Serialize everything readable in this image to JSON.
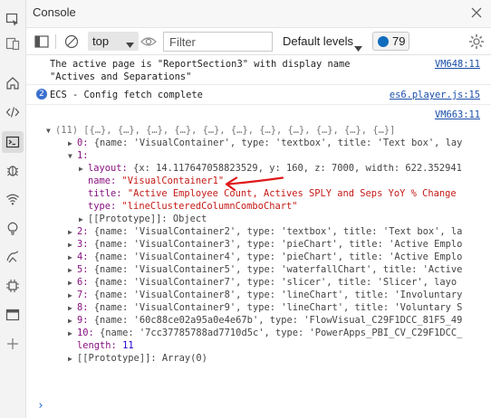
{
  "header": {
    "title": "Console"
  },
  "toolbar": {
    "context": "top",
    "filter_placeholder": "Filter",
    "levels_label": "Default levels",
    "issues_count": "79"
  },
  "messages": [
    {
      "text": "The active page is \"ReportSection3\" with display name\n\"Actives and Separations\"",
      "source": "VM648:11"
    },
    {
      "badge": "2",
      "text": "ECS - Config fetch complete",
      "source": "es6.player.js:15"
    },
    {
      "source": "VM663:11"
    }
  ],
  "object": {
    "summary": "(11) [{…}, {…}, {…}, {…}, {…}, {…}, {…}, {…}, {…}, {…}, {…}]",
    "item0": "{name: 'VisualContainer', type: 'textbox', title: 'Text box', lay",
    "item1_layout_key": "layout:",
    "item1_layout_val": "{x: 14.117647058823529, y: 160, z: 7000, width: 622.352941",
    "item1_name_key": "name:",
    "item1_name_val": "\"VisualContainer1\"",
    "item1_title_key": "title:",
    "item1_title_val": "\"Active Employee Count, Actives SPLY and Seps YoY % Change",
    "item1_type_key": "type:",
    "item1_type_val": "\"lineClusteredColumnComboChart\"",
    "item1_proto": "[[Prototype]]: Object",
    "rows": [
      {
        "idx": "2:",
        "text": "{name: 'VisualContainer2', type: 'textbox', title: 'Text box', la"
      },
      {
        "idx": "3:",
        "text": "{name: 'VisualContainer3', type: 'pieChart', title: 'Active Emplo"
      },
      {
        "idx": "4:",
        "text": "{name: 'VisualContainer4', type: 'pieChart', title: 'Active Emplo"
      },
      {
        "idx": "5:",
        "text": "{name: 'VisualContainer5', type: 'waterfallChart', title: 'Active"
      },
      {
        "idx": "6:",
        "text": "{name: 'VisualContainer7', type: 'slicer', title: 'Slicer', layo"
      },
      {
        "idx": "7:",
        "text": "{name: 'VisualContainer8', type: 'lineChart', title: 'Involuntary"
      },
      {
        "idx": "8:",
        "text": "{name: 'VisualContainer9', type: 'lineChart', title: 'Voluntary S"
      },
      {
        "idx": "9:",
        "text": "{name: '60c88ce02a95a0e4e67b', type: 'FlowVisual_C29F1DCC_81F5_49"
      },
      {
        "idx": "10:",
        "text": "{name: '7cc37785788ad7710d5c', type: 'PowerApps_PBI_CV_C29F1DCC_"
      }
    ],
    "length_key": "length:",
    "length_val": "11",
    "proto_array": "[[Prototype]]: Array(0)"
  },
  "prompt": "›",
  "colors": {
    "annotation": "#e0181b",
    "link": "#1a4ea8",
    "accent": "#0f6cbd"
  }
}
